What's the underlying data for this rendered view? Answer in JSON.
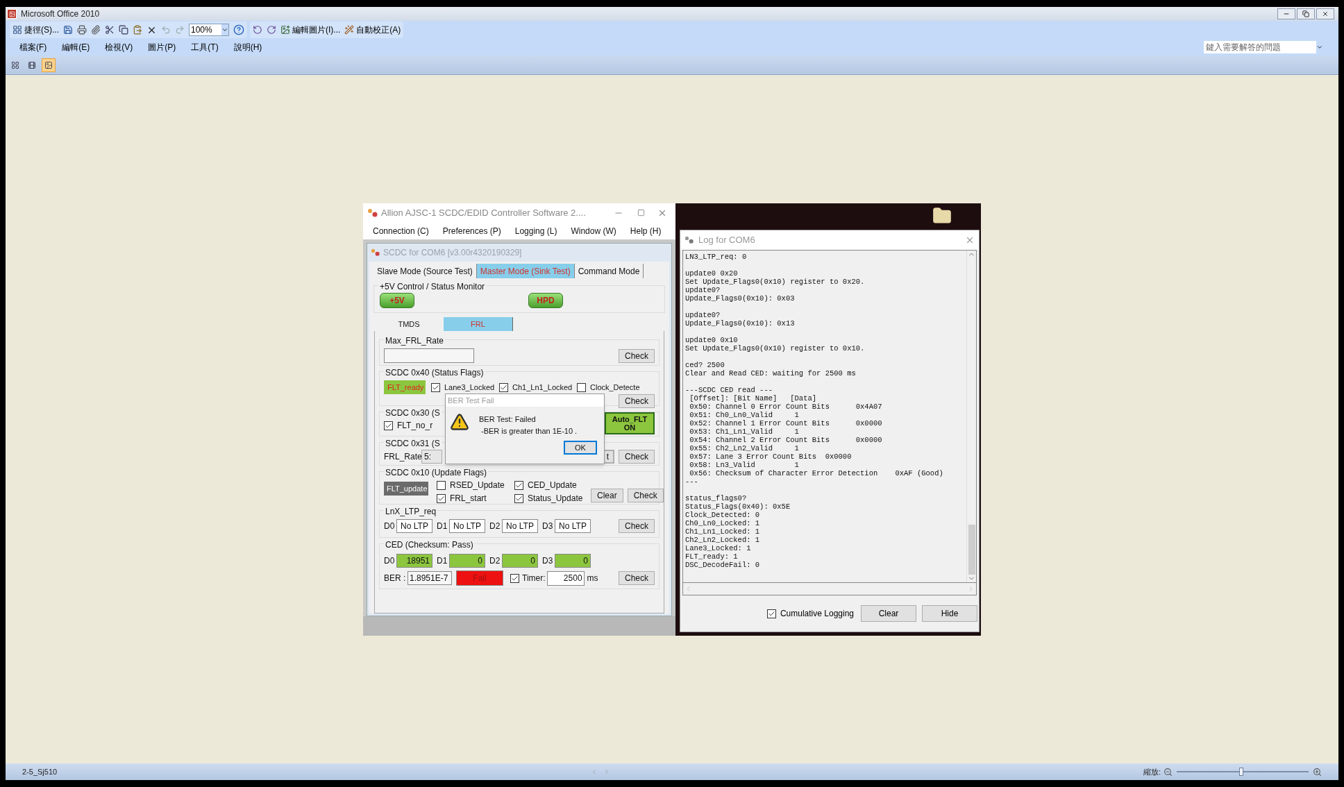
{
  "app": {
    "title": "Microsoft Office 2010"
  },
  "toolbar": {
    "shortcut": "捷徑(S)...",
    "zoom": "100%",
    "edit_picture": "編輯圖片(I)...",
    "auto_correct": "自動校正(A)"
  },
  "menu": [
    "檔案(F)",
    "編輯(E)",
    "檢視(V)",
    "圖片(P)",
    "工具(T)",
    "說明(H)"
  ],
  "help_search": {
    "placeholder": "鍵入需要解答的問題"
  },
  "view_buttons": [
    {
      "selected": false
    },
    {
      "selected": false
    },
    {
      "selected": true
    }
  ],
  "controller": {
    "title": "Allion AJSC-1 SCDC/EDID Controller Software 2....",
    "menu": [
      "Connection (C)",
      "Preferences (P)",
      "Logging (L)",
      "Window (W)",
      "Help (H)"
    ],
    "child": {
      "title": "SCDC for COM6 [v3.00r4320190329]",
      "tabs": [
        {
          "label": "Slave Mode (Source Test)",
          "selected": false
        },
        {
          "label": "Master Mode (Sink Test)",
          "selected": true
        },
        {
          "label": "Command Mode",
          "selected": false
        }
      ],
      "power": {
        "title": "+5V Control / Status Monitor",
        "buttons": [
          "+5V",
          "HPD"
        ]
      },
      "subtabs": [
        {
          "label": "TMDS",
          "selected": false
        },
        {
          "label": "FRL",
          "selected": true
        }
      ],
      "max_frl_rate": {
        "title": "Max_FRL_Rate",
        "button": "Check"
      },
      "status_flags": {
        "title": "SCDC 0x40 (Status Flags)",
        "indicator": {
          "label": "FLT_ready",
          "on": true
        },
        "checks": [
          {
            "label": "Lane3_Locked",
            "checked": true
          },
          {
            "label": "Ch1_Ln1_Locked",
            "checked": true
          },
          {
            "label": "Clock_Detecte",
            "checked": false
          }
        ],
        "button": "Check"
      },
      "scdc_30": {
        "title": "SCDC 0x30 (S",
        "check": {
          "label": "FLT_no_r",
          "checked": true
        },
        "button": [
          "Auto_FLT",
          "ON"
        ]
      },
      "scdc_31": {
        "title": "SCDC 0x31 (S",
        "label": "FRL_Rate",
        "value": "5:",
        "buttons": [
          "t",
          "Check"
        ]
      },
      "update_flags": {
        "title": "SCDC 0x10 (Update Flags)",
        "indicator": {
          "label": "FLT_update",
          "on": false
        },
        "checks": [
          {
            "label": "RSED_Update",
            "checked": false
          },
          {
            "label": "CED_Update",
            "checked": true
          },
          {
            "label": "FRL_start",
            "checked": true
          },
          {
            "label": "Status_Update",
            "checked": true
          }
        ],
        "buttons": [
          "Clear",
          "Check"
        ]
      },
      "ltp": {
        "title": "LnX_LTP_req",
        "lanes": [
          {
            "label": "D0",
            "value": "No LTP"
          },
          {
            "label": "D1",
            "value": "No LTP"
          },
          {
            "label": "D2",
            "value": "No LTP"
          },
          {
            "label": "D3",
            "value": "No LTP"
          }
        ],
        "button": "Check"
      },
      "ced": {
        "title": "CED (Checksum: Pass)",
        "lanes": [
          {
            "label": "D0",
            "value": "18951",
            "ok": true
          },
          {
            "label": "D1",
            "value": "0",
            "ok": true
          },
          {
            "label": "D2",
            "value": "0",
            "ok": true
          },
          {
            "label": "D3",
            "value": "0",
            "ok": true
          }
        ],
        "ber_label": "BER :",
        "ber": "1.8951E-7",
        "result": {
          "label": "Fail",
          "pass": false
        },
        "timer": {
          "label": "Timer:",
          "checked": true,
          "value": "2500",
          "unit": "ms"
        },
        "button": "Check"
      }
    }
  },
  "dialog": {
    "title": "BER Test Fail",
    "lines": [
      "BER Test: Failed",
      "-BER is greater than 1E-10 ."
    ],
    "button": "OK"
  },
  "log": {
    "title": "Log for COM6",
    "blocks": [
      [
        "LN3_LTP_req: 0"
      ],
      [
        "update0 0x20",
        "Set Update_Flags0(0x10) register to 0x20.",
        "update0?",
        "Update_Flags0(0x10): 0x03"
      ],
      [
        "update0?",
        "Update_Flags0(0x10): 0x13"
      ],
      [
        "update0 0x10",
        "Set Update_Flags0(0x10) register to 0x10."
      ],
      [
        "ced? 2500",
        "Clear and Read CED: waiting for 2500 ms"
      ],
      [
        "---SCDC CED read ---",
        " [Offset]: [Bit Name]   [Data]",
        " 0x50: Channel 0 Error Count Bits      0x4A07",
        " 0x51: Ch0_Ln0_Valid     1",
        " 0x52: Channel 1 Error Count Bits      0x0000",
        " 0x53: Ch1_Ln1_Valid     1",
        " 0x54: Channel 2 Error Count Bits      0x0000",
        " 0x55: Ch2_Ln2_Valid     1",
        " 0x57: Lane 3 Error Count Bits  0x0000",
        " 0x58: Ln3_Valid         1",
        " 0x56: Checksum of Character Error Detection    0xAF (Good)",
        "---"
      ],
      [
        "status_flags0?",
        "Status_Flags(0x40): 0x5E",
        "Clock_Detected: 0",
        "Ch0_Ln0_Locked: 1",
        "Ch1_Ln1_Locked: 1",
        "Ch2_Ln2_Locked: 1",
        "Lane3_Locked: 1",
        "FLT_ready: 1",
        "DSC_DecodeFail: 0"
      ]
    ],
    "cumulative": {
      "label": "Cumulative Logging",
      "checked": true
    },
    "buttons": [
      "Clear",
      "Hide"
    ]
  },
  "status_bar": {
    "file": "2-5_Sj510",
    "zoom_label": "縮放:",
    "zoom": {
      "level": 0.49
    }
  }
}
